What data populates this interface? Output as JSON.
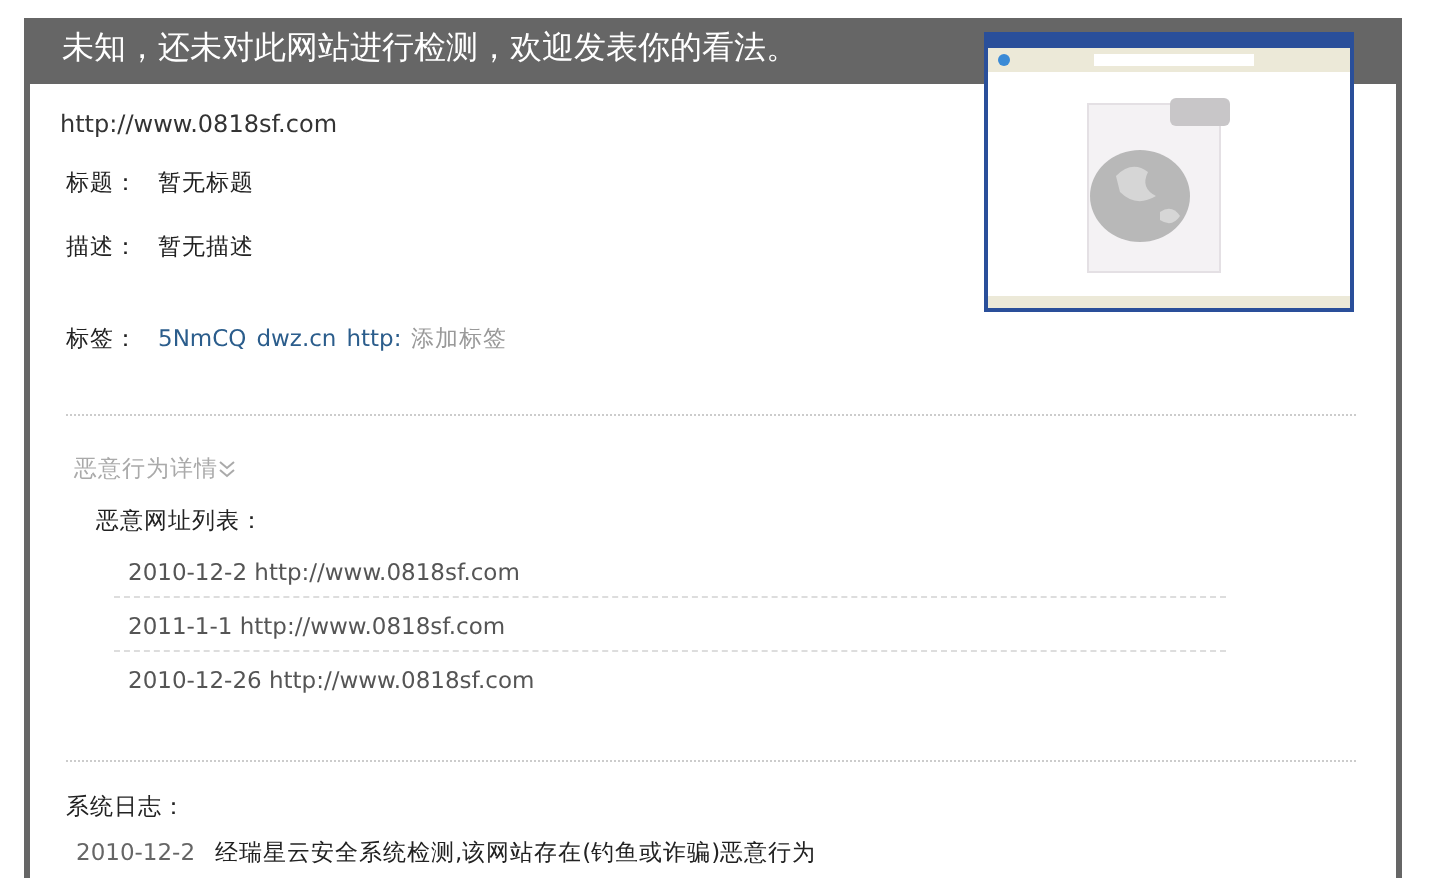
{
  "header": {
    "title": "未知，还未对此网站进行检测，欢迎发表你的看法。"
  },
  "url": "http://www.0818sf.com",
  "fields": [
    {
      "label": "标题：",
      "value": "暂无标题"
    },
    {
      "label": "描述：",
      "value": "暂无描述"
    }
  ],
  "tags": {
    "label": "标签：",
    "items": [
      "5NmCQ",
      "dwz.cn",
      "http:"
    ],
    "add_link": "添加标签"
  },
  "malicious": {
    "toggle": "恶意行为详情",
    "expanded": true,
    "list_title": "恶意网址列表：",
    "entries": [
      {
        "date": "2010-12-2",
        "url": "http://www.0818sf.com"
      },
      {
        "date": "2011-1-1",
        "url": "http://www.0818sf.com"
      },
      {
        "date": "2010-12-26",
        "url": "http://www.0818sf.com"
      }
    ]
  },
  "system_log": {
    "title": "系统日志：",
    "entries": [
      {
        "date": "2010-12-2",
        "text": "经瑞星云安全系统检测,该网站存在(钓鱼或诈骗)恶意行为"
      }
    ]
  }
}
